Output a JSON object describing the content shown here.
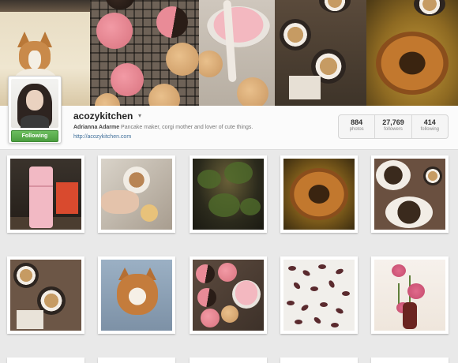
{
  "profile": {
    "username": "acozykitchen",
    "caret": "▾",
    "full_name": "Adrianna Adarme",
    "bio": "Pancake maker, corgi mother and lover of cute things.",
    "website": "http://acozykitchen.com",
    "follow_button_label": "Following"
  },
  "stats": [
    {
      "value": "884",
      "label": "photos"
    },
    {
      "value": "27,769",
      "label": "followers"
    },
    {
      "value": "414",
      "label": "following"
    }
  ],
  "colors": {
    "follow_green": "#4c9e40",
    "link_blue": "#3d6d99",
    "page_bg": "#e9e9e9"
  }
}
